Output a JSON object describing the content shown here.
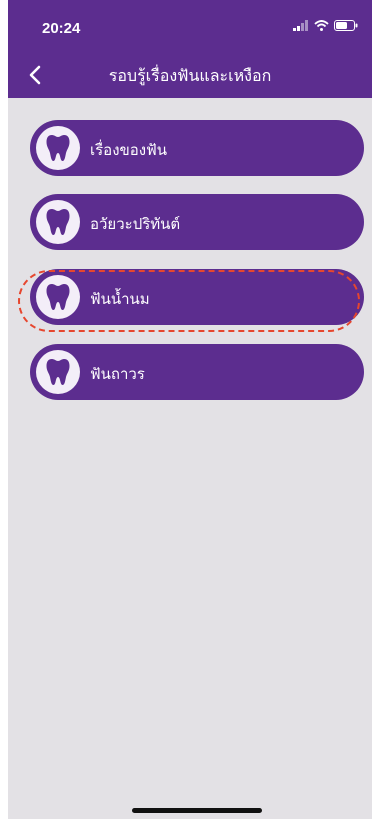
{
  "status": {
    "time": "20:24",
    "icons": [
      "signal-icon",
      "wifi-icon",
      "battery-icon"
    ]
  },
  "header": {
    "back_icon": "chevron-left-icon",
    "title": "รอบรู้เรื่องฟันและเหงือก"
  },
  "menu": {
    "items": [
      {
        "icon": "tooth-icon",
        "label": "เรื่องของฟัน"
      },
      {
        "icon": "tooth-icon",
        "label": "อวัยวะปริทันต์"
      },
      {
        "icon": "tooth-icon",
        "label": "ฟันน้ำนม",
        "highlighted": true
      },
      {
        "icon": "tooth-icon",
        "label": "ฟันถาวร"
      }
    ]
  },
  "colors": {
    "primary": "#5c2d8f",
    "background": "#e3e1e5",
    "icon_bg": "#f3eef8",
    "highlight": "#e6462e"
  }
}
